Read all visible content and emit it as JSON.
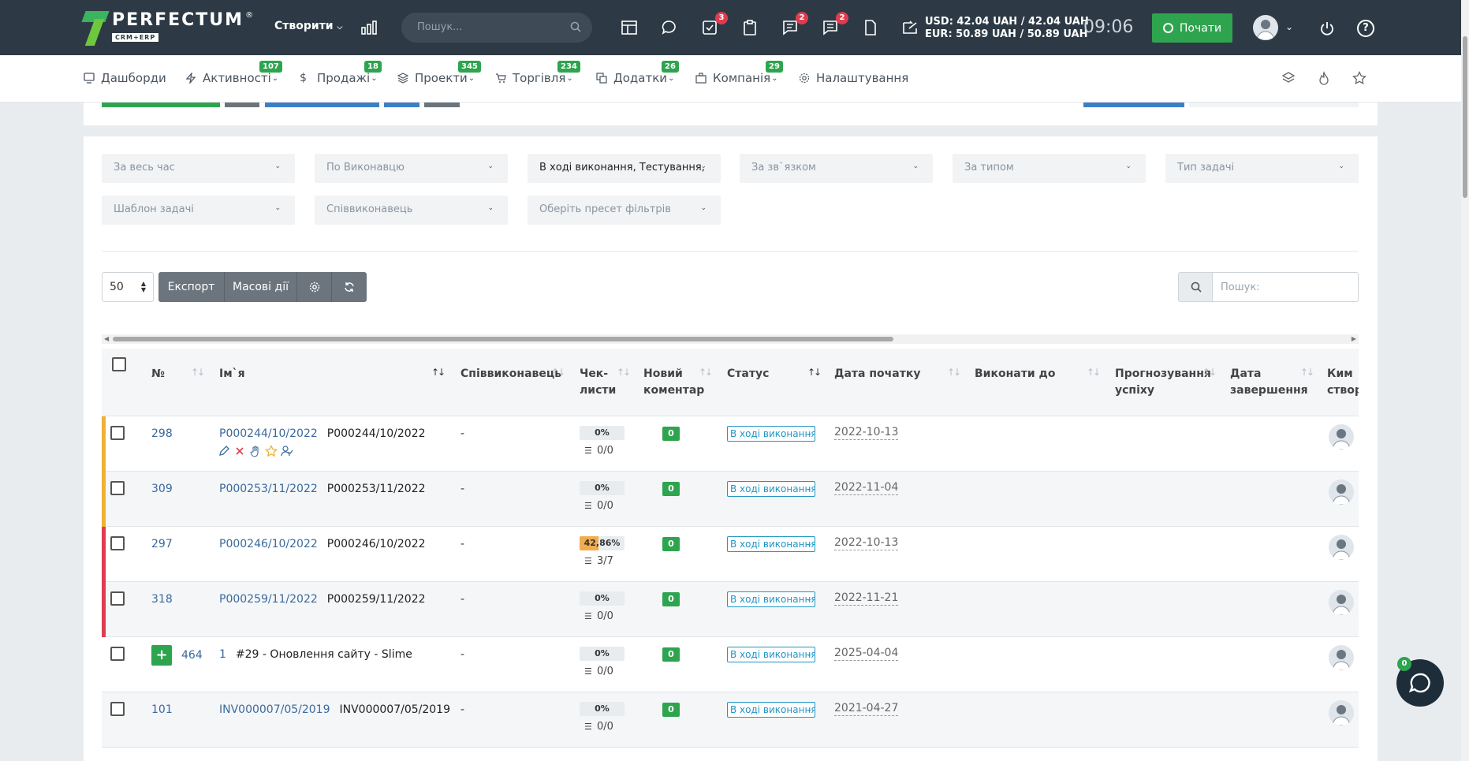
{
  "header": {
    "logo_name": "PERFECTUM",
    "logo_reg": "®",
    "logo_sub": "CRM+ERP",
    "create_label": "Створити",
    "search_placeholder": "Пошук...",
    "tasks_badge": "3",
    "messages_badge": "2",
    "comments_badge": "2",
    "usd_rate": "USD: 42.04 UAH / 42.04 UAH",
    "eur_rate": "EUR: 50.89 UAH / 50.89 UAH",
    "clock": "09:06",
    "start_label": "Почати"
  },
  "nav": {
    "items": [
      {
        "label": "Дашборди",
        "badge": ""
      },
      {
        "label": "Активності",
        "badge": "107"
      },
      {
        "label": "Продажі",
        "badge": "18"
      },
      {
        "label": "Проекти",
        "badge": "345"
      },
      {
        "label": "Торгівля",
        "badge": "234"
      },
      {
        "label": "Додатки",
        "badge": "26"
      },
      {
        "label": "Компанія",
        "badge": "29"
      },
      {
        "label": "Налаштування",
        "badge": ""
      }
    ]
  },
  "filters": [
    "За весь час",
    "По Виконавцю",
    "В ході виконання, Тестування,",
    "За зв`язком",
    "За типом",
    "Тип задачі",
    "Шаблон задачі",
    "Співвиконавець",
    "Оберіть пресет фільтрів"
  ],
  "toolbar": {
    "page_size": "50",
    "export_label": "Експорт",
    "bulk_label": "Масові дії",
    "search_placeholder": "Пошук:"
  },
  "table": {
    "headers": {
      "num": "№",
      "name": "Ім`я",
      "coexec": "Співвиконавець",
      "checklists_1": "Чек-",
      "checklists_2": "листи",
      "newcomment_1": "Новий",
      "newcomment_2": "коментар",
      "status": "Статус",
      "start_date": "Дата початку",
      "due": "Виконати до",
      "forecast_1": "Прогнозування",
      "forecast_2": "успіху",
      "end_1": "Дата",
      "end_2": "завершення",
      "by_1": "Ким",
      "by_2": "створ"
    },
    "rows": [
      {
        "num": "298",
        "code": "P000244/10/2022",
        "name": "P000244/10/2022",
        "coexec": "-",
        "pct": "0%",
        "pct_value": 0,
        "check": "0/0",
        "comments": "0",
        "status": "В ході виконання",
        "start": "2022-10-13",
        "mark": "#f0b232"
      },
      {
        "num": "309",
        "code": "P000253/11/2022",
        "name": "P000253/11/2022",
        "coexec": "-",
        "pct": "0%",
        "pct_value": 0,
        "check": "0/0",
        "comments": "0",
        "status": "В ході виконання",
        "start": "2022-11-04",
        "mark": "#f0b232"
      },
      {
        "num": "297",
        "code": "P000246/10/2022",
        "name": "P000246/10/2022",
        "coexec": "-",
        "pct": "42,86%",
        "pct_value": 42.86,
        "check": "3/7",
        "comments": "0",
        "status": "В ході виконання",
        "start": "2022-10-13",
        "mark": "#e03c4f"
      },
      {
        "num": "318",
        "code": "P000259/11/2022",
        "name": "P000259/11/2022",
        "coexec": "-",
        "pct": "0%",
        "pct_value": 0,
        "check": "0/0",
        "comments": "0",
        "status": "В ході виконання",
        "start": "2022-11-21",
        "mark": "#e03c4f"
      },
      {
        "num": "464",
        "code": "1",
        "name": "#29 - Оновлення сайту - Slime",
        "coexec": "-",
        "pct": "0%",
        "pct_value": 0,
        "check": "0/0",
        "comments": "0",
        "status": "В ході виконання",
        "start": "2025-04-04",
        "mark": ""
      },
      {
        "num": "101",
        "code": "INV000007/05/2019",
        "name": "INV000007/05/2019",
        "coexec": "-",
        "pct": "0%",
        "pct_value": 0,
        "check": "0/0",
        "comments": "0",
        "status": "В ході виконання",
        "start": "2021-04-27",
        "mark": ""
      }
    ]
  },
  "chat_badge": "0",
  "colors": {
    "topbar": "#2d3a45",
    "accent": "#2ea44f",
    "link": "#3a6a9c",
    "status": "#2196c4"
  }
}
